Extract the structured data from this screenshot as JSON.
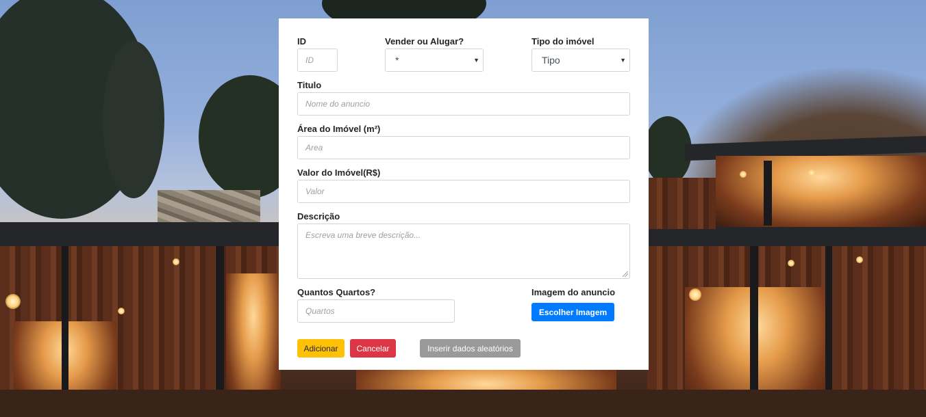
{
  "form": {
    "id": {
      "label": "ID",
      "placeholder": "ID"
    },
    "deal": {
      "label": "Vender ou Alugar?",
      "selected": "*"
    },
    "type": {
      "label": "Tipo do imóvel",
      "selected": "Tipo"
    },
    "title": {
      "label": "Titulo",
      "placeholder": "Nome do anuncio"
    },
    "area": {
      "label": "Área do Imóvel (m²)",
      "placeholder": "Area"
    },
    "value": {
      "label": "Valor do Imóvel(R$)",
      "placeholder": "Valor"
    },
    "description": {
      "label": "Descrição",
      "placeholder": "Escreva uma breve descrição..."
    },
    "rooms": {
      "label": "Quantos Quartos?",
      "placeholder": "Quartos"
    },
    "image": {
      "label": "Imagem do anuncio",
      "button": "Escolher Imagem"
    }
  },
  "actions": {
    "add": "Adicionar",
    "cancel": "Cancelar",
    "random": "Inserir dados aleatórios"
  },
  "colors": {
    "warning": "#ffc107",
    "danger": "#dc3545",
    "secondary": "#9a9a9a",
    "primary": "#007bff"
  }
}
